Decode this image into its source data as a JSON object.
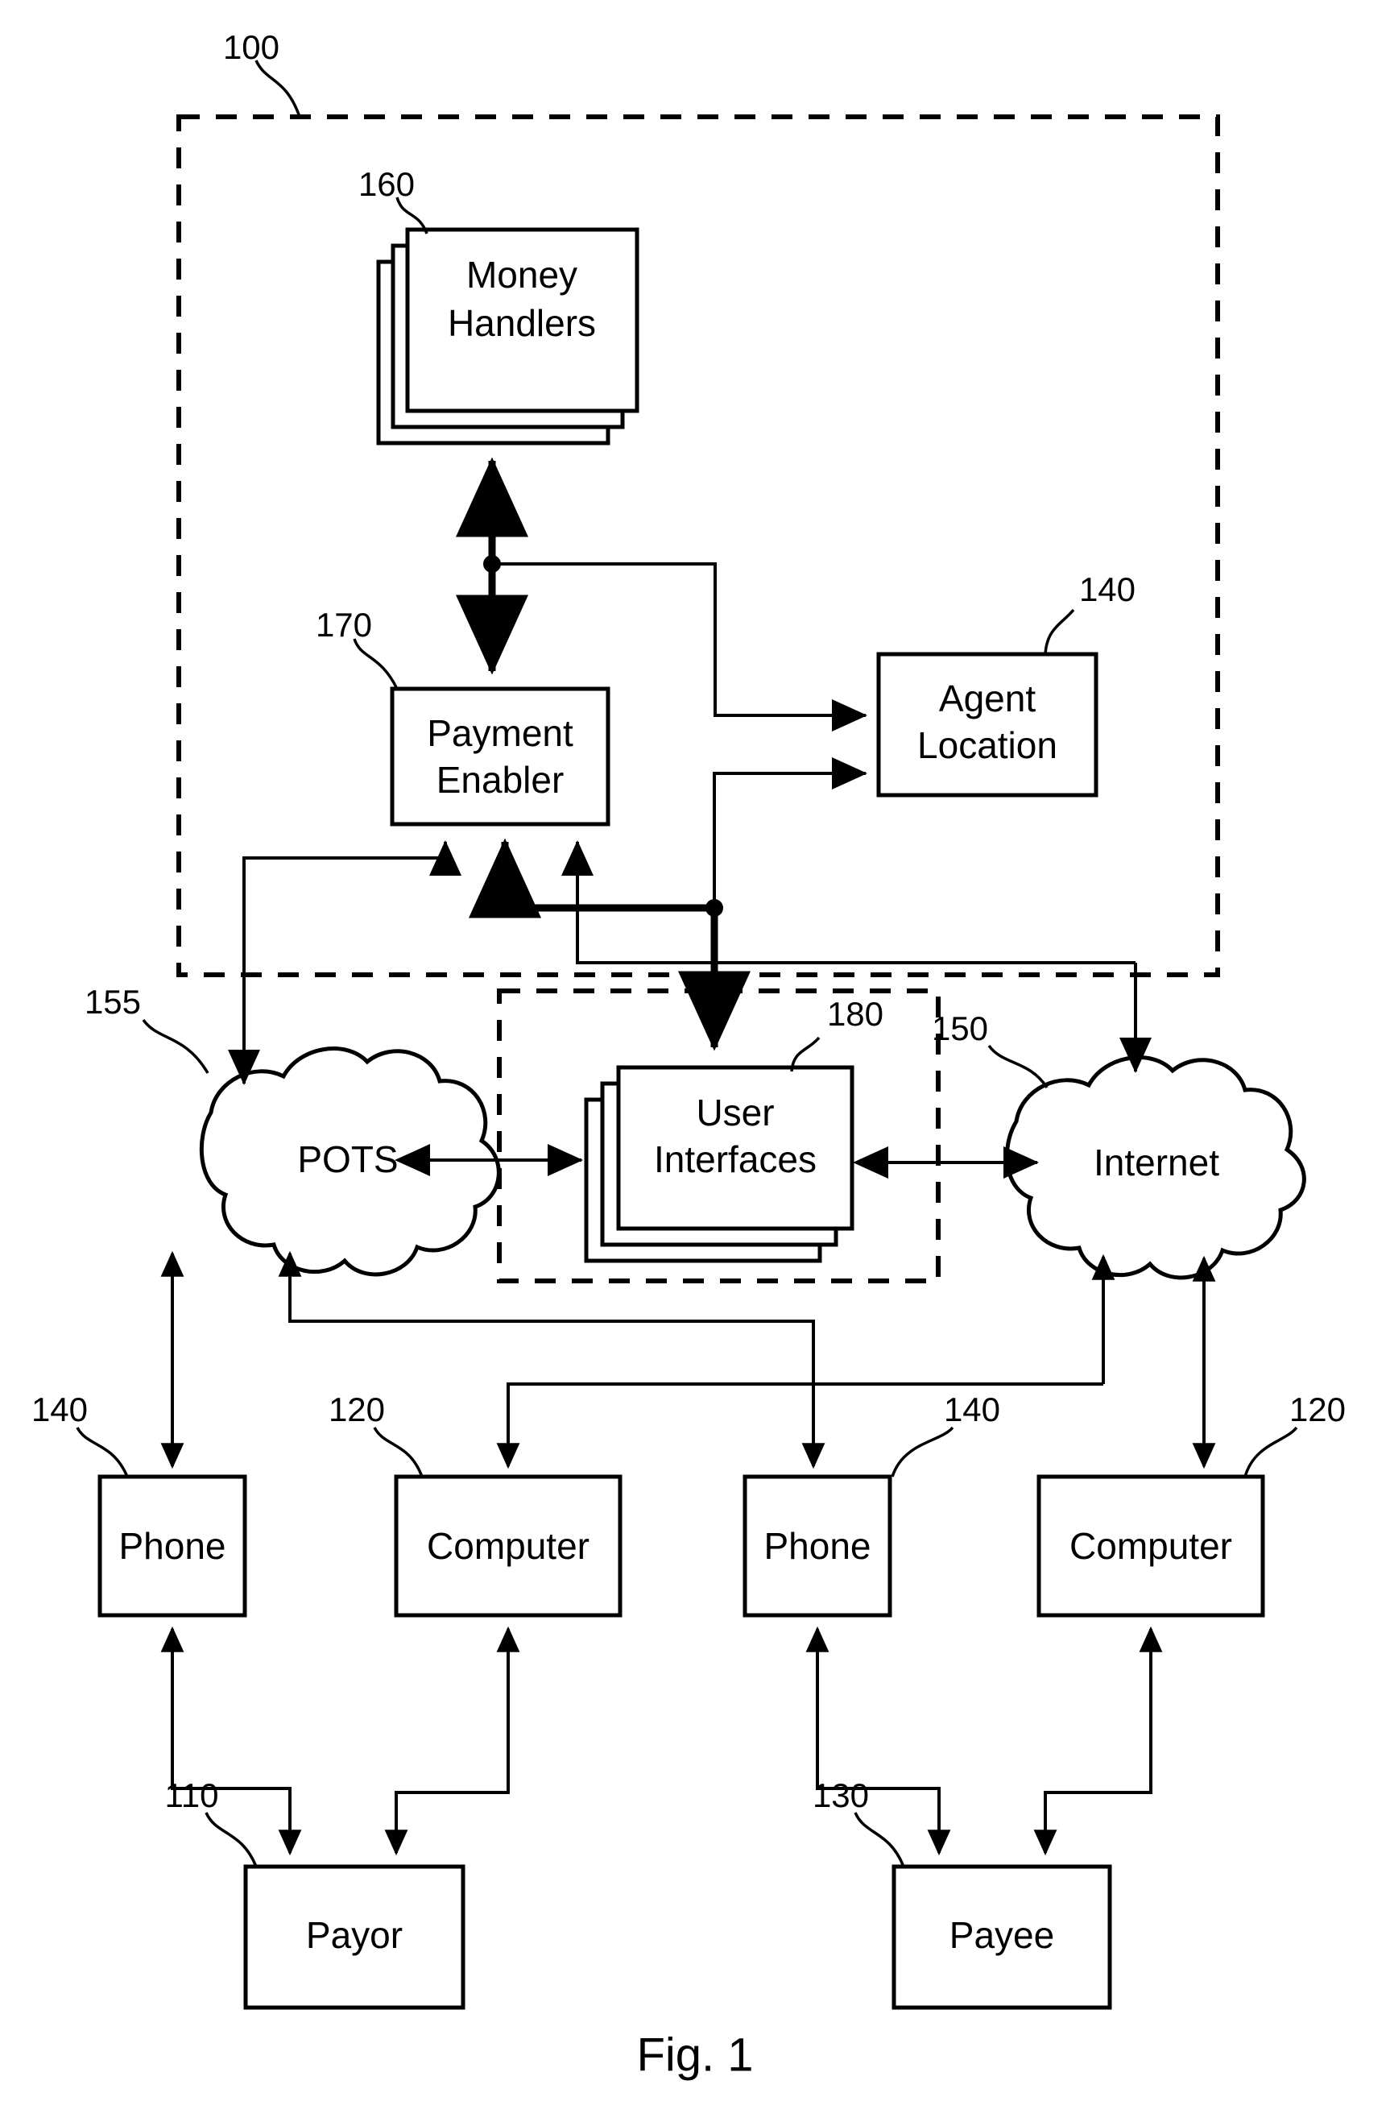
{
  "figure": {
    "caption": "Fig. 1",
    "system_ref": "100"
  },
  "regions": [
    {
      "id": "system-boundary",
      "ref": "100",
      "kind": "dashed-rectangle"
    },
    {
      "id": "user-interface-boundary",
      "ref": "180",
      "kind": "dashed-rectangle"
    }
  ],
  "nodes": {
    "money_handlers": {
      "label_line1": "Money",
      "label_line2": "Handlers",
      "ref": "160",
      "shape": "stacked-box"
    },
    "payment_enabler": {
      "label_line1": "Payment",
      "label_line2": "Enabler",
      "ref": "170",
      "shape": "box"
    },
    "agent_location": {
      "label_line1": "Agent",
      "label_line2": "Location",
      "ref": "140",
      "shape": "box"
    },
    "user_interfaces": {
      "label_line1": "User",
      "label_line2": "Interfaces",
      "ref": "180",
      "shape": "stacked-box"
    },
    "pots": {
      "label": "POTS",
      "ref": "155",
      "shape": "cloud"
    },
    "internet": {
      "label": "Internet",
      "ref": "150",
      "shape": "cloud"
    },
    "phone_left": {
      "label": "Phone",
      "ref": "140",
      "shape": "box"
    },
    "computer_left": {
      "label": "Computer",
      "ref": "120",
      "shape": "box"
    },
    "phone_right": {
      "label": "Phone",
      "ref": "140",
      "shape": "box"
    },
    "computer_right": {
      "label": "Computer",
      "ref": "120",
      "shape": "box"
    },
    "payor": {
      "label": "Payor",
      "ref": "110",
      "shape": "box"
    },
    "payee": {
      "label": "Payee",
      "ref": "130",
      "shape": "box"
    }
  },
  "reference_numerals": [
    {
      "value": "100",
      "target": "system-boundary"
    },
    {
      "value": "160",
      "target": "money_handlers"
    },
    {
      "value": "170",
      "target": "payment_enabler"
    },
    {
      "value": "140",
      "target": "agent_location"
    },
    {
      "value": "180",
      "target": "user_interfaces"
    },
    {
      "value": "155",
      "target": "pots"
    },
    {
      "value": "150",
      "target": "internet"
    },
    {
      "value": "140",
      "target": "phone_left"
    },
    {
      "value": "120",
      "target": "computer_left"
    },
    {
      "value": "140",
      "target": "phone_right"
    },
    {
      "value": "120",
      "target": "computer_right"
    },
    {
      "value": "110",
      "target": "payor"
    },
    {
      "value": "130",
      "target": "payee"
    }
  ],
  "connections": [
    {
      "from": "payment_enabler",
      "to": "money_handlers",
      "style": "bidirectional-thick"
    },
    {
      "from": "payment_enabler_branch",
      "to": "agent_location",
      "style": "arrow"
    },
    {
      "from": "user_interfaces_branch",
      "to": "agent_location",
      "style": "arrow"
    },
    {
      "from": "payment_enabler",
      "to": "user_interfaces",
      "style": "arrow-thick"
    },
    {
      "from": "payment_enabler",
      "to": "pots",
      "style": "arrow"
    },
    {
      "from": "user_interfaces",
      "to": "pots",
      "style": "bidirectional"
    },
    {
      "from": "user_interfaces",
      "to": "internet",
      "style": "bidirectional"
    },
    {
      "from": "payment_enabler",
      "to": "internet",
      "style": "arrow"
    },
    {
      "from": "pots",
      "to": "phone_left",
      "style": "bidirectional"
    },
    {
      "from": "user_interfaces_lower",
      "to": "computer_left",
      "style": "arrow"
    },
    {
      "from": "pots_lower",
      "to": "phone_right",
      "style": "arrow"
    },
    {
      "from": "internet",
      "to": "computer_right",
      "style": "bidirectional"
    },
    {
      "from": "phone_left",
      "to": "payor",
      "style": "bidirectional"
    },
    {
      "from": "computer_left",
      "to": "payor",
      "style": "bidirectional"
    },
    {
      "from": "phone_right",
      "to": "payee",
      "style": "bidirectional"
    },
    {
      "from": "computer_right",
      "to": "payee",
      "style": "bidirectional"
    }
  ],
  "colors": {
    "ink": "#000000",
    "paper": "#ffffff"
  }
}
